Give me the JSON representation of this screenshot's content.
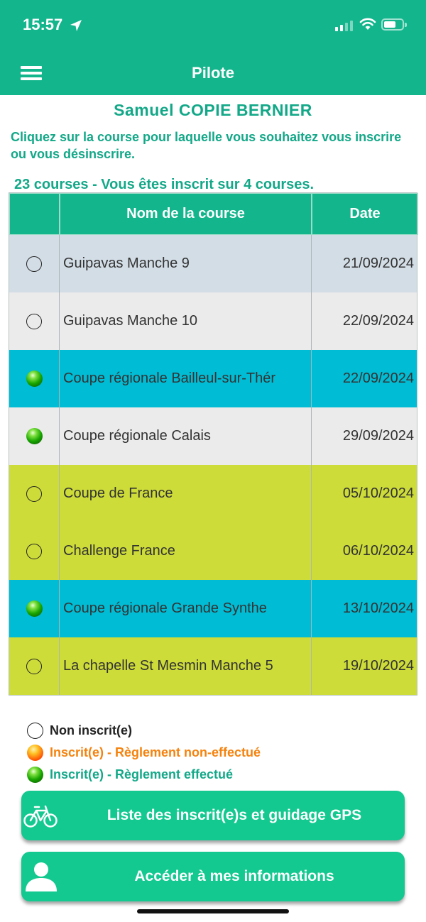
{
  "status": {
    "time": "15:57"
  },
  "header": {
    "title": "Pilote"
  },
  "pilot": {
    "name": "Samuel COPIE BERNIER"
  },
  "instructions": "Cliquez sur la course pour laquelle vous souhaitez vous inscrire ou vous désinscrire.",
  "summary": "23 courses - Vous êtes inscrit sur 4 courses.",
  "table": {
    "headers": {
      "status": "",
      "name": "Nom de la course",
      "date": "Date"
    },
    "rows": [
      {
        "name": "Guipavas Manche 9",
        "date": "21/09/2024",
        "state": "not_registered",
        "bg": "#d3dde6"
      },
      {
        "name": "Guipavas Manche 10",
        "date": "22/09/2024",
        "state": "not_registered",
        "bg": "#ebebeb"
      },
      {
        "name": "Coupe régionale Bailleul-sur-Thér",
        "date": "22/09/2024",
        "state": "paid",
        "bg": "#00bcd4"
      },
      {
        "name": "Coupe régionale Calais",
        "date": "29/09/2024",
        "state": "paid",
        "bg": "#ebebeb"
      },
      {
        "name": "Coupe de France",
        "date": "05/10/2024",
        "state": "not_registered",
        "bg": "#cddc39"
      },
      {
        "name": "Challenge France",
        "date": "06/10/2024",
        "state": "not_registered",
        "bg": "#cddc39"
      },
      {
        "name": "Coupe régionale Grande Synthe",
        "date": "13/10/2024",
        "state": "paid",
        "bg": "#00bcd4"
      },
      {
        "name": "La chapelle St Mesmin Manche 5",
        "date": "19/10/2024",
        "state": "not_registered",
        "bg": "#cddc39"
      }
    ]
  },
  "legend": {
    "not_registered": {
      "label": "Non inscrit(e)",
      "color": "#222222"
    },
    "unpaid": {
      "label": "Inscrit(e) - Règlement non-effectué",
      "color": "#f5820d"
    },
    "paid": {
      "label": "Inscrit(e) - Règlement effectué",
      "color": "#13a888"
    }
  },
  "buttons": {
    "registrants": {
      "label": "Liste des inscrit(e)s et guidage GPS",
      "icon": "bicycle-icon"
    },
    "my_info": {
      "label": "Accéder à mes informations",
      "icon": "user-icon"
    }
  },
  "colors": {
    "brand": "#13b58c",
    "button": "#13c98f"
  }
}
